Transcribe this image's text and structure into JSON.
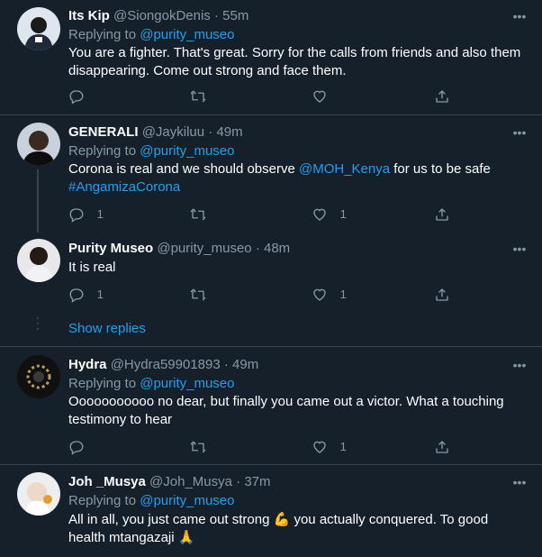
{
  "colors": {
    "background": "#15202b",
    "text": "#ffffff",
    "muted": "#8899a6",
    "accent": "#1da1f2",
    "divider": "#38444d"
  },
  "tweets": [
    {
      "name": "Its Kip",
      "handle": "@SiongokDenis",
      "dot": "·",
      "time": "55m",
      "replying_prefix": "Replying to ",
      "replying_handle": "@purity_museo",
      "text": "You are a fighter. That's great. Sorry for the calls from friends and also them disappearing. Come out strong and face them.",
      "reply_count": "",
      "retweet_count": "",
      "like_count": ""
    },
    {
      "name": "GENERALI",
      "handle": "@Jaykiluu",
      "dot": "·",
      "time": "49m",
      "replying_prefix": "Replying to ",
      "replying_handle": "@purity_museo",
      "text_part1": "Corona is real and we should observe ",
      "mention": "@MOH_Kenya",
      "text_part2": " for us to be safe",
      "hashtag": "#AngamizaCorona",
      "reply_count": "1",
      "retweet_count": "",
      "like_count": "1"
    },
    {
      "name": "Purity Museo",
      "handle": "@purity_museo",
      "dot": "·",
      "time": "48m",
      "text": "It is real",
      "reply_count": "1",
      "retweet_count": "",
      "like_count": "1"
    },
    {
      "name": "Hydra",
      "handle": "@Hydra59901893",
      "dot": "·",
      "time": "49m",
      "replying_prefix": "Replying to ",
      "replying_handle": "@purity_museo",
      "text": "Ooooooooooo no dear, but finally you came out a victor. What a touching testimony to hear",
      "reply_count": "",
      "retweet_count": "",
      "like_count": "1"
    },
    {
      "name": "Joh _Musya",
      "handle": "@Joh_Musya",
      "dot": "·",
      "time": "37m",
      "replying_prefix": "Replying to ",
      "replying_handle": "@purity_museo",
      "text_part1": "All in all, you just came out strong ",
      "emoji1": "💪",
      "text_part2": " you actually conquered. To good health mtangazaji ",
      "emoji2": "🙏"
    }
  ],
  "show_replies": "Show replies",
  "more_glyph": "•••"
}
